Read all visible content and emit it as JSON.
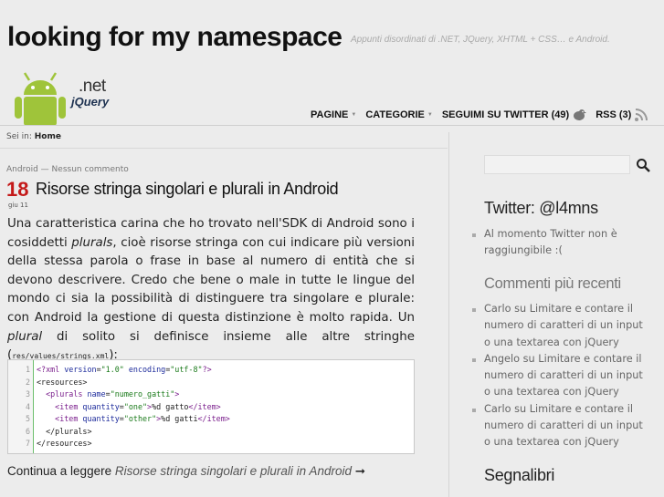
{
  "site": {
    "title": "looking for my namespace",
    "tagline": "Appunti disordinati di .NET, JQuery, XHTML + CSS… e Android."
  },
  "logo": {
    "net": ".net",
    "jquery": "jQuery"
  },
  "nav": {
    "pagine": "PAGINE",
    "categorie": "CATEGORIE",
    "twitter": "SEGUIMI SU TWITTER (49)",
    "rss": "RSS (3)"
  },
  "breadcrumb": {
    "prefix": "Sei in:",
    "current": "Home"
  },
  "post": {
    "category": "Android",
    "separator": "—",
    "comments": "Nessun commento",
    "day": "18",
    "month_year": "giu 11",
    "title": "Risorse stringa singolari e plurali in Android",
    "body_1": "Una caratteristica carina che ho trovato nell'SDK di Android sono i cosiddetti ",
    "body_plurals": "plurals",
    "body_2": ", cioè risorse stringa con cui indicare più versioni della stessa parola o frase in base al numero di entità che si devono descrivere. Credo che bene o male in tutte le lingue del mondo ci sia la possibilità di distinguere tra singolare e plurale: con Android la gestione di questa distinzione è molto rapida. Un ",
    "body_plural": "plural",
    "body_3": " di solito si definisce insieme alle altre stringhe (",
    "body_code": "res/values/strings.xml",
    "body_4": "):",
    "code_lines": [
      "1",
      "2",
      "3",
      "4",
      "5",
      "6",
      "7"
    ],
    "code": {
      "l1_open": "<?xml ",
      "l1_a1": "version",
      "l1_eq1": "=",
      "l1_v1": "\"1.0\"",
      "l1_a2": " encoding",
      "l1_eq2": "=",
      "l1_v2": "\"utf-8\"",
      "l1_close": "?>",
      "l2": "<resources>",
      "l3_open": "  <plurals ",
      "l3_a": "name",
      "l3_eq": "=",
      "l3_v": "\"numero_gatti\"",
      "l3_close": ">",
      "l4_open": "    <item ",
      "l4_a": "quantity",
      "l4_eq": "=",
      "l4_v": "\"one\"",
      "l4_close": ">",
      "l4_text": "%d gatto",
      "l4_end": "</item>",
      "l5_open": "    <item ",
      "l5_a": "quantity",
      "l5_eq": "=",
      "l5_v": "\"other\"",
      "l5_close": ">",
      "l5_text": "%d gatti",
      "l5_end": "</item>",
      "l6": "  </plurals>",
      "l7": "</resources>"
    },
    "continue_label": "Continua a leggere ",
    "continue_link": "Risorse stringa singolari e plurali in Android",
    "continue_arrow": "➞"
  },
  "sidebar": {
    "twitter_title": "Twitter: @l4mns",
    "twitter_items": [
      "Al momento Twitter non è raggiungibile :("
    ],
    "comments_title": "Commenti più recenti",
    "comments_items": [
      "Carlo su Limitare e contare il numero di caratteri di un input o una textarea con jQuery",
      "Angelo su Limitare e contare il numero di caratteri di un input o una textarea con jQuery",
      "Carlo su Limitare e contare il numero di caratteri di un input o una textarea con jQuery"
    ],
    "bookmarks_title": "Segnalibri"
  },
  "colors": {
    "date_red": "#c41a1a",
    "android_green": "#9fc43a",
    "jquery_blue": "#1d3150"
  },
  "icons": {
    "search": "search-icon",
    "rss": "rss-icon",
    "twitter": "twitter-bird-icon"
  }
}
